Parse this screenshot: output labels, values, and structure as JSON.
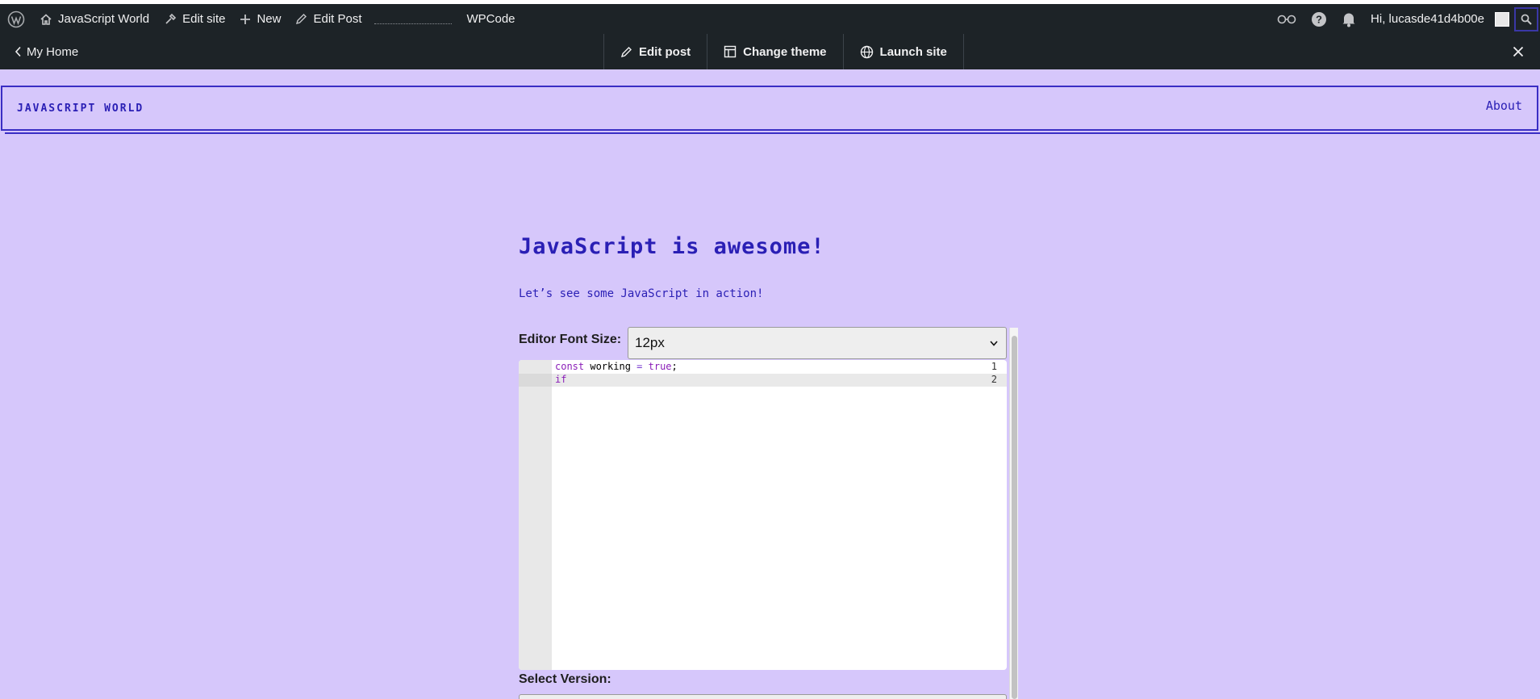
{
  "adminbar": {
    "site_name": "JavaScript World",
    "edit_site": "Edit site",
    "new": "New",
    "edit_post": "Edit Post",
    "plugin": "WPCode",
    "greeting": "Hi, lucasde41d4b00e"
  },
  "launchbar": {
    "my_home": "My Home",
    "edit_post": "Edit post",
    "change_theme": "Change theme",
    "launch_site": "Launch site"
  },
  "site": {
    "title": "JavaScript World",
    "nav_about": "About"
  },
  "post": {
    "title": "JavaScript is awesome!",
    "paragraph": "Let’s see some JavaScript in action!"
  },
  "editor": {
    "font_size_label": "Editor Font Size:",
    "font_size_value": "12px",
    "lines": [
      {
        "number": "1",
        "kw": "const",
        "text": " working ",
        "op": "=",
        "val": " true",
        "end": ";"
      },
      {
        "number": "2",
        "kw": "if"
      }
    ],
    "version_label": "Select Version:"
  },
  "colors": {
    "page_bg": "#d6c7fb",
    "accent": "#2a1fb5",
    "admin_bg": "#1d2327"
  }
}
